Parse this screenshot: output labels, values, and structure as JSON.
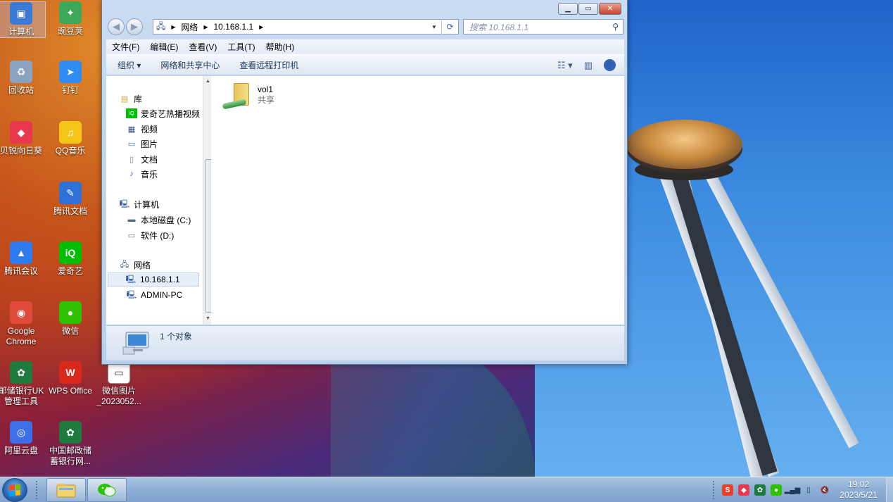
{
  "desktop": {
    "icons": [
      {
        "label": "计算机",
        "icon": "computer-icon",
        "color": "#3b7bd6"
      },
      {
        "label": "豌豆荚",
        "icon": "wandoujia-icon",
        "color": "#3da857"
      },
      {
        "label": "回收站",
        "icon": "recycle-bin-icon",
        "color": "#8aa4c0"
      },
      {
        "label": "钉钉",
        "icon": "dingtalk-icon",
        "color": "#2f8cf0"
      },
      {
        "label": "贝锐向日葵",
        "icon": "sunflower-icon",
        "color": "#e8384f"
      },
      {
        "label": "QQ音乐",
        "icon": "qqmusic-icon",
        "color": "#f5c518"
      },
      {
        "label": "腾讯文档",
        "icon": "tencent-docs-icon",
        "color": "#2f6fd8"
      },
      {
        "label": "腾讯会议",
        "icon": "tencent-meeting-icon",
        "color": "#2f7cf0"
      },
      {
        "label": "爱奇艺",
        "icon": "iqiyi-icon",
        "color": "#00be06"
      },
      {
        "label": "Google Chrome",
        "icon": "chrome-icon",
        "color": "#e04a3a"
      },
      {
        "label": "微信",
        "icon": "wechat-icon",
        "color": "#2dc100"
      },
      {
        "label": "邮储银行UK管理工具",
        "icon": "psbc-uk-icon",
        "color": "#1f7a3e"
      },
      {
        "label": "WPS Office",
        "icon": "wps-icon",
        "color": "#d9291c"
      },
      {
        "label": "微信图片_2023052...",
        "icon": "image-file-icon",
        "color": "#ffffff"
      },
      {
        "label": "阿里云盘",
        "icon": "aliyun-drive-icon",
        "color": "#3d6fe8"
      },
      {
        "label": "中国邮政储蓄银行网...",
        "icon": "psbc-web-icon",
        "color": "#1f7a3e"
      }
    ]
  },
  "window": {
    "address": {
      "crumbs": [
        "网络",
        "10.168.1.1"
      ]
    },
    "search_placeholder": "搜索 10.168.1.1",
    "menu": [
      "文件(F)",
      "编辑(E)",
      "查看(V)",
      "工具(T)",
      "帮助(H)"
    ],
    "toolbar": {
      "organize": "组织",
      "network_center": "网络和共享中心",
      "printers": "查看远程打印机"
    },
    "nav": {
      "library": "库",
      "library_items": [
        "爱奇艺热播视频",
        "视频",
        "图片",
        "文档",
        "音乐"
      ],
      "computer": "计算机",
      "computer_items": [
        "本地磁盘 (C:)",
        "软件 (D:)"
      ],
      "network": "网络",
      "network_items": [
        "10.168.1.1",
        "ADMIN-PC"
      ]
    },
    "content": {
      "item_name": "vol1",
      "item_sub": "共享"
    },
    "status": "1 个对象"
  },
  "taskbar": {
    "time": "19:02",
    "date": "2023/5/21"
  }
}
